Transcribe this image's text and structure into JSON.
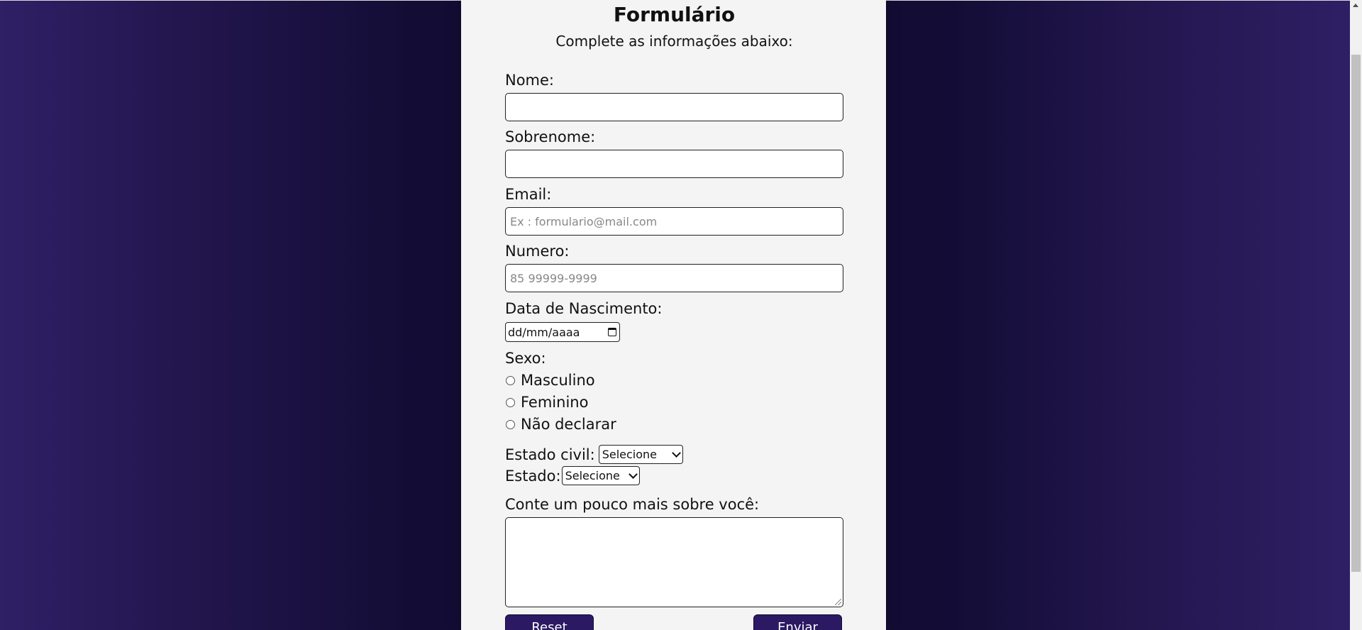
{
  "form": {
    "title": "Formulário",
    "subtitle": "Complete as informações abaixo:",
    "fields": {
      "nome_label": "Nome:",
      "nome_value": "",
      "sobrenome_label": "Sobrenome:",
      "sobrenome_value": "",
      "email_label": "Email:",
      "email_placeholder": "Ex : formulario@mail.com",
      "numero_label": "Numero:",
      "numero_placeholder": "85 99999-9999",
      "nascimento_label": "Data de Nascimento:",
      "nascimento_placeholder": "dd/mm/aaaa"
    },
    "sexo": {
      "label": "Sexo:",
      "options": [
        "Masculino",
        "Feminino",
        "Não declarar"
      ]
    },
    "estado_civil": {
      "label": "Estado civil:",
      "selected": "Selecione"
    },
    "estado": {
      "label": "Estado:",
      "selected": "Selecione"
    },
    "sobre": {
      "label": "Conte um pouco mais sobre você:",
      "value": ""
    },
    "buttons": {
      "reset": "Reset",
      "enviar": "Enviar"
    }
  },
  "colors": {
    "background_edge": "#2f1f66",
    "background_center": "#130d36",
    "card": "#f4f4f4",
    "button": "#2b1a63"
  }
}
